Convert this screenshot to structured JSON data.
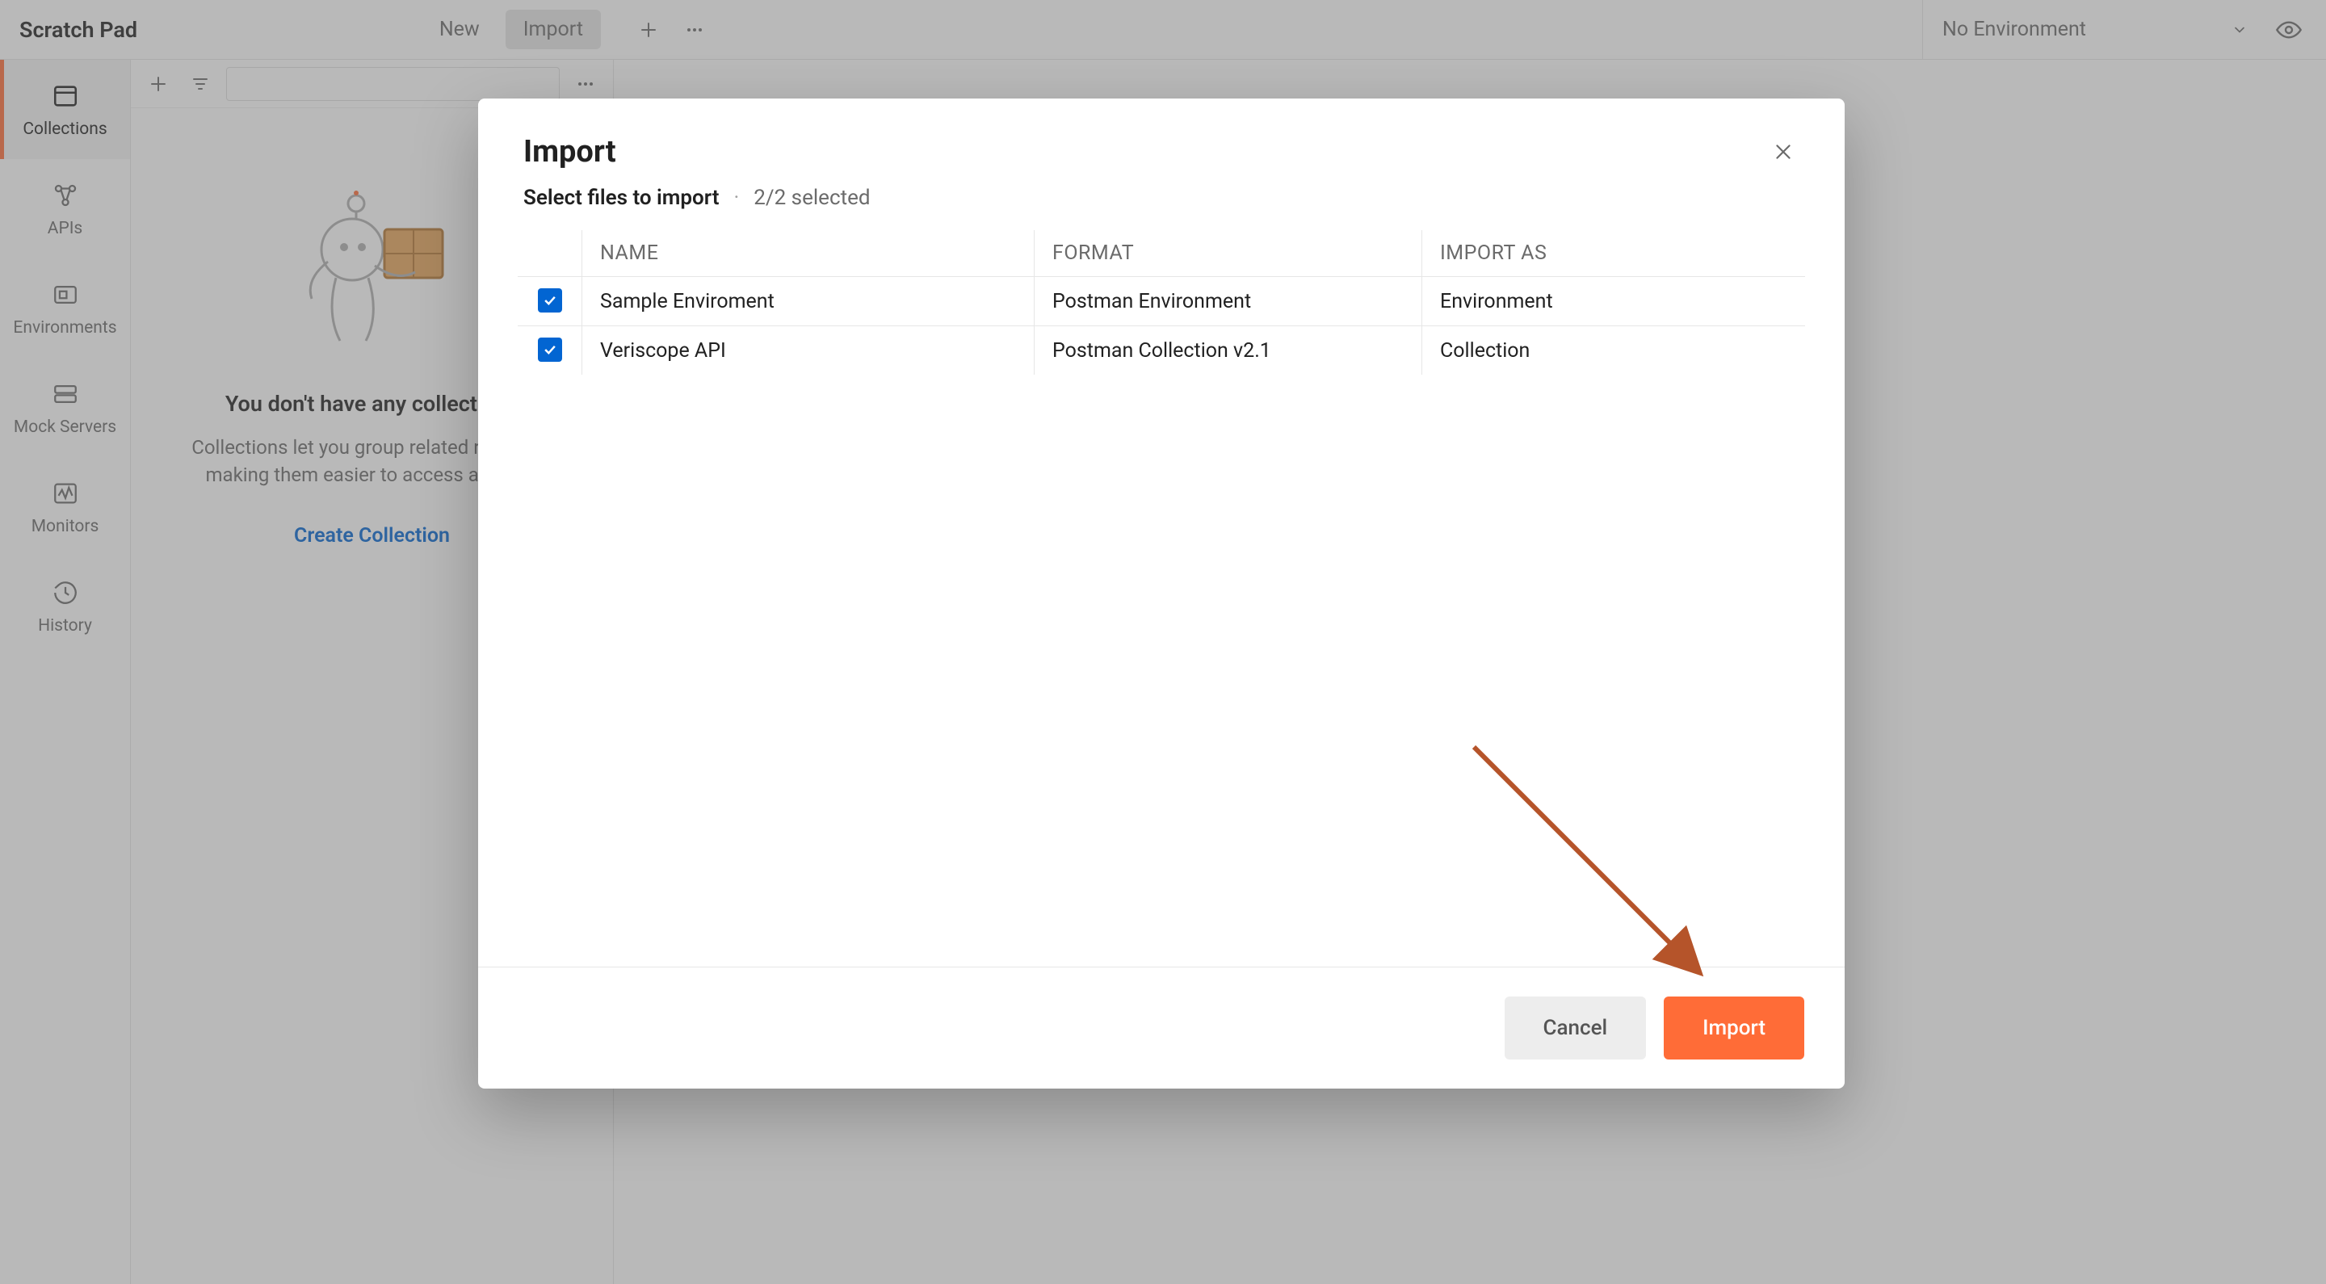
{
  "topbar": {
    "title": "Scratch Pad",
    "new_label": "New",
    "import_label": "Import",
    "env_label": "No Environment"
  },
  "siderail": {
    "items": [
      {
        "label": "Collections"
      },
      {
        "label": "APIs"
      },
      {
        "label": "Environments"
      },
      {
        "label": "Mock Servers"
      },
      {
        "label": "Monitors"
      },
      {
        "label": "History"
      }
    ]
  },
  "empty": {
    "heading": "You don't have any collections",
    "body": "Collections let you group related requests, making them easier to access and run.",
    "cta": "Create Collection"
  },
  "modal": {
    "title": "Import",
    "subtitle": "Select files to import",
    "selected_text": "2/2 selected",
    "columns": {
      "name": "NAME",
      "format": "FORMAT",
      "import_as": "IMPORT AS"
    },
    "rows": [
      {
        "name": "Sample Enviroment",
        "format": "Postman Environment",
        "import_as": "Environment",
        "checked": true
      },
      {
        "name": "Veriscope API",
        "format": "Postman Collection v2.1",
        "import_as": "Collection",
        "checked": true
      }
    ],
    "cancel_label": "Cancel",
    "import_label": "Import"
  }
}
